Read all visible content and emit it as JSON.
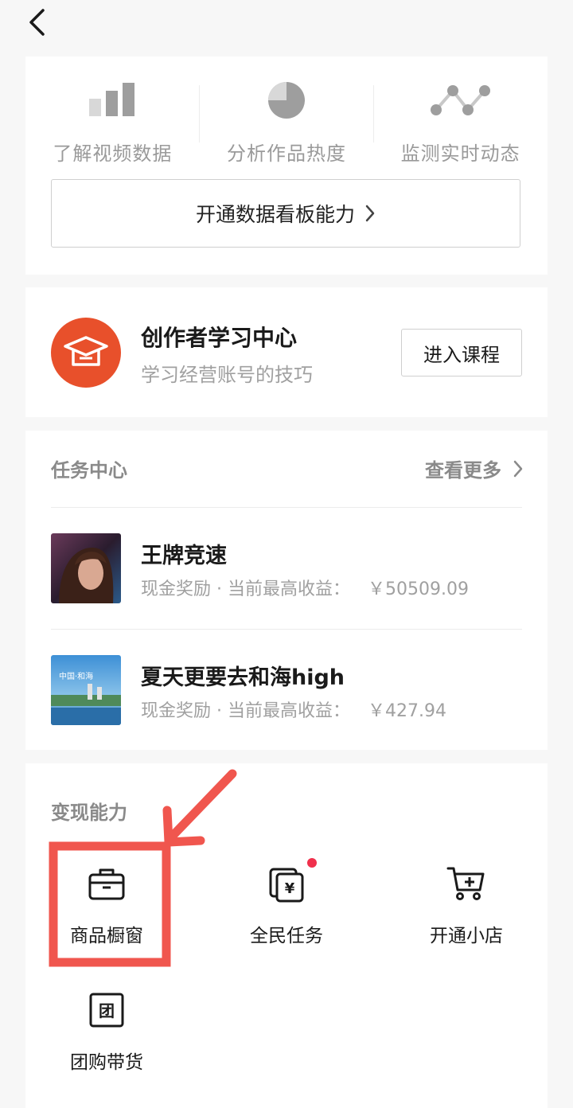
{
  "nav": {
    "back_icon": "chevron-left-icon"
  },
  "data_panel": {
    "features": [
      {
        "icon": "bar-chart-icon",
        "label": "了解视频数据"
      },
      {
        "icon": "pie-chart-icon",
        "label": "分析作品热度"
      },
      {
        "icon": "line-trend-icon",
        "label": "监测实时动态"
      }
    ],
    "open_button_label": "开通数据看板能力"
  },
  "learning": {
    "icon": "graduation-cap-icon",
    "title": "创作者学习中心",
    "subtitle": "学习经营账号的技巧",
    "button_label": "进入课程",
    "accent_color": "#e8502b"
  },
  "tasks": {
    "heading": "任务中心",
    "see_more_label": "查看更多",
    "items": [
      {
        "title": "王牌竞速",
        "desc": "现金奖励 · 当前最高收益：",
        "reward": "￥50509.09"
      },
      {
        "title": "夏天更要去和海high",
        "desc": "现金奖励 · 当前最高收益：",
        "reward": "￥427.94"
      }
    ]
  },
  "monetization": {
    "heading": "变现能力",
    "tools": [
      {
        "icon": "briefcase-icon",
        "label": "商品橱窗"
      },
      {
        "icon": "yuan-cards-icon",
        "label": "全民任务",
        "has_badge": true
      },
      {
        "icon": "cart-add-icon",
        "label": "开通小店"
      },
      {
        "icon": "group-buy-icon",
        "label": "团购带货"
      }
    ],
    "annotation_color": "#f0564e"
  }
}
